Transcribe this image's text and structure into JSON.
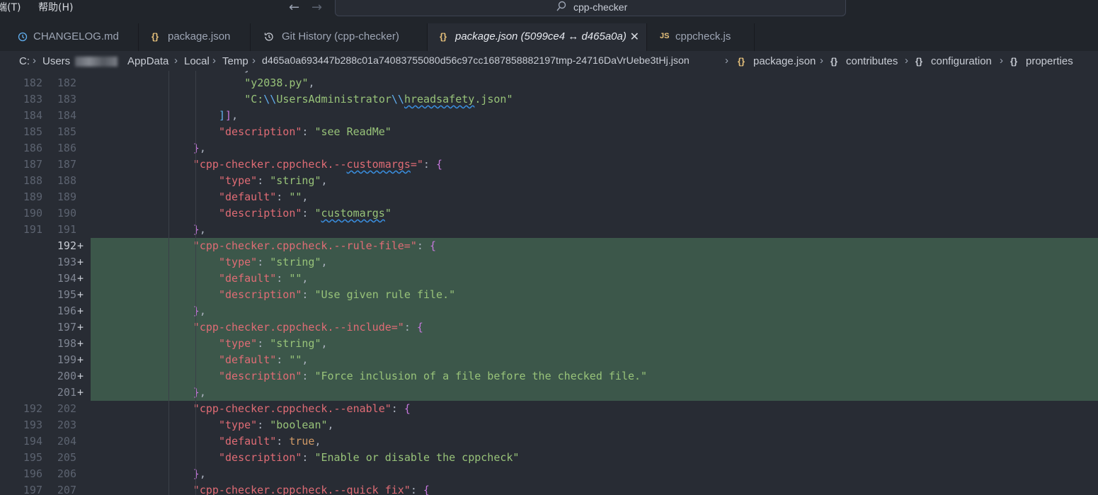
{
  "menu": {
    "item1": "端(T)",
    "item2": "帮助(H)"
  },
  "command_center": {
    "text": "cpp-checker"
  },
  "tabs": [
    {
      "icon": "history",
      "label": "CHANGELOG.md"
    },
    {
      "icon": "{}",
      "label": "package.json"
    },
    {
      "icon": "history",
      "label": "Git History (cpp-checker)"
    },
    {
      "icon": "{}",
      "label": "package.json (5099ce4 ↔ d465a0a)"
    },
    {
      "icon": "JS",
      "label": "cppcheck.js"
    }
  ],
  "breadcrumb": {
    "drive": "C:",
    "users": "Users",
    "appdata": "AppData",
    "local": "Local",
    "temp": "Temp",
    "folder": "d465a0a693447b288c01a74083755080d56c97cc1687858882197tmp-24716DaVrUebe3tHj.json",
    "json_icon": "{}",
    "file": "package.json",
    "obj_icon": "{}",
    "s1": "contributes",
    "s2": "configuration",
    "s3": "properties"
  },
  "lines": [
    {
      "old": "182",
      "new": "182",
      "plus": "",
      "p1": "",
      "s1": "\"y2038.py\"",
      "p2": ","
    },
    {
      "old": "183",
      "new": "183",
      "plus": "",
      "p1": "",
      "s1": "\"C:\\\\UsersAdministrator\\\\hreadsafety.json\"",
      "p2": ""
    },
    {
      "old": "184",
      "new": "184",
      "plus": ""
    },
    {
      "old": "185",
      "new": "185",
      "plus": "",
      "k": "\"description\"",
      "p": ": ",
      "s": "\"see ReadMe\""
    },
    {
      "old": "186",
      "new": "186",
      "plus": ""
    },
    {
      "old": "187",
      "new": "187",
      "plus": "",
      "k": "\"cpp-checker.cppcheck.--customargs=\"",
      "p": ": "
    },
    {
      "old": "188",
      "new": "188",
      "plus": "",
      "k": "\"type\"",
      "p": ": ",
      "s": "\"string\"",
      "e": ","
    },
    {
      "old": "189",
      "new": "189",
      "plus": "",
      "k": "\"default\"",
      "p": ": ",
      "s": "\"\"",
      "e": ","
    },
    {
      "old": "190",
      "new": "190",
      "plus": "",
      "k": "\"description\"",
      "p": ": ",
      "s": "\"customargs\""
    },
    {
      "old": "191",
      "new": "191",
      "plus": ""
    },
    {
      "old": "",
      "new": "192",
      "plus": "+",
      "k": "\"cpp-checker.cppcheck.--rule-file=\"",
      "p": ": "
    },
    {
      "old": "",
      "new": "193",
      "plus": "+",
      "k": "\"type\"",
      "p": ": ",
      "s": "\"string\"",
      "e": ","
    },
    {
      "old": "",
      "new": "194",
      "plus": "+",
      "k": "\"default\"",
      "p": ": ",
      "s": "\"\"",
      "e": ","
    },
    {
      "old": "",
      "new": "195",
      "plus": "+",
      "k": "\"description\"",
      "p": ": ",
      "s": "\"Use given rule file.\""
    },
    {
      "old": "",
      "new": "196",
      "plus": "+"
    },
    {
      "old": "",
      "new": "197",
      "plus": "+",
      "k": "\"cpp-checker.cppcheck.--include=\"",
      "p": ": "
    },
    {
      "old": "",
      "new": "198",
      "plus": "+",
      "k": "\"type\"",
      "p": ": ",
      "s": "\"string\"",
      "e": ","
    },
    {
      "old": "",
      "new": "199",
      "plus": "+",
      "k": "\"default\"",
      "p": ": ",
      "s": "\"\"",
      "e": ","
    },
    {
      "old": "",
      "new": "200",
      "plus": "+",
      "k": "\"description\"",
      "p": ": ",
      "s": "\"Force inclusion of a file before the checked file.\""
    },
    {
      "old": "",
      "new": "201",
      "plus": "+"
    },
    {
      "old": "192",
      "new": "202",
      "plus": "",
      "k": "\"cpp-checker.cppcheck.--enable\"",
      "p": ": "
    },
    {
      "old": "193",
      "new": "203",
      "plus": "",
      "k": "\"type\"",
      "p": ": ",
      "s": "\"boolean\"",
      "e": ","
    },
    {
      "old": "194",
      "new": "204",
      "plus": "",
      "k": "\"default\"",
      "p": ": ",
      "kw": "true",
      "e": ","
    },
    {
      "old": "195",
      "new": "205",
      "plus": "",
      "k": "\"description\"",
      "p": ": ",
      "s": "\"Enable or disable the cppcheck\""
    },
    {
      "old": "196",
      "new": "206",
      "plus": ""
    },
    {
      "old": "197",
      "new": "207",
      "plus": "",
      "k": "\"cpp-checker.cppcheck.--quick_fix\"",
      "p": ": "
    }
  ],
  "colors": {
    "added_background": "#3c574a",
    "key": "#e06c75",
    "string": "#98c379",
    "keyword": "#d19a66",
    "bracket1": "#c678dd",
    "bracket2": "#61afef"
  }
}
